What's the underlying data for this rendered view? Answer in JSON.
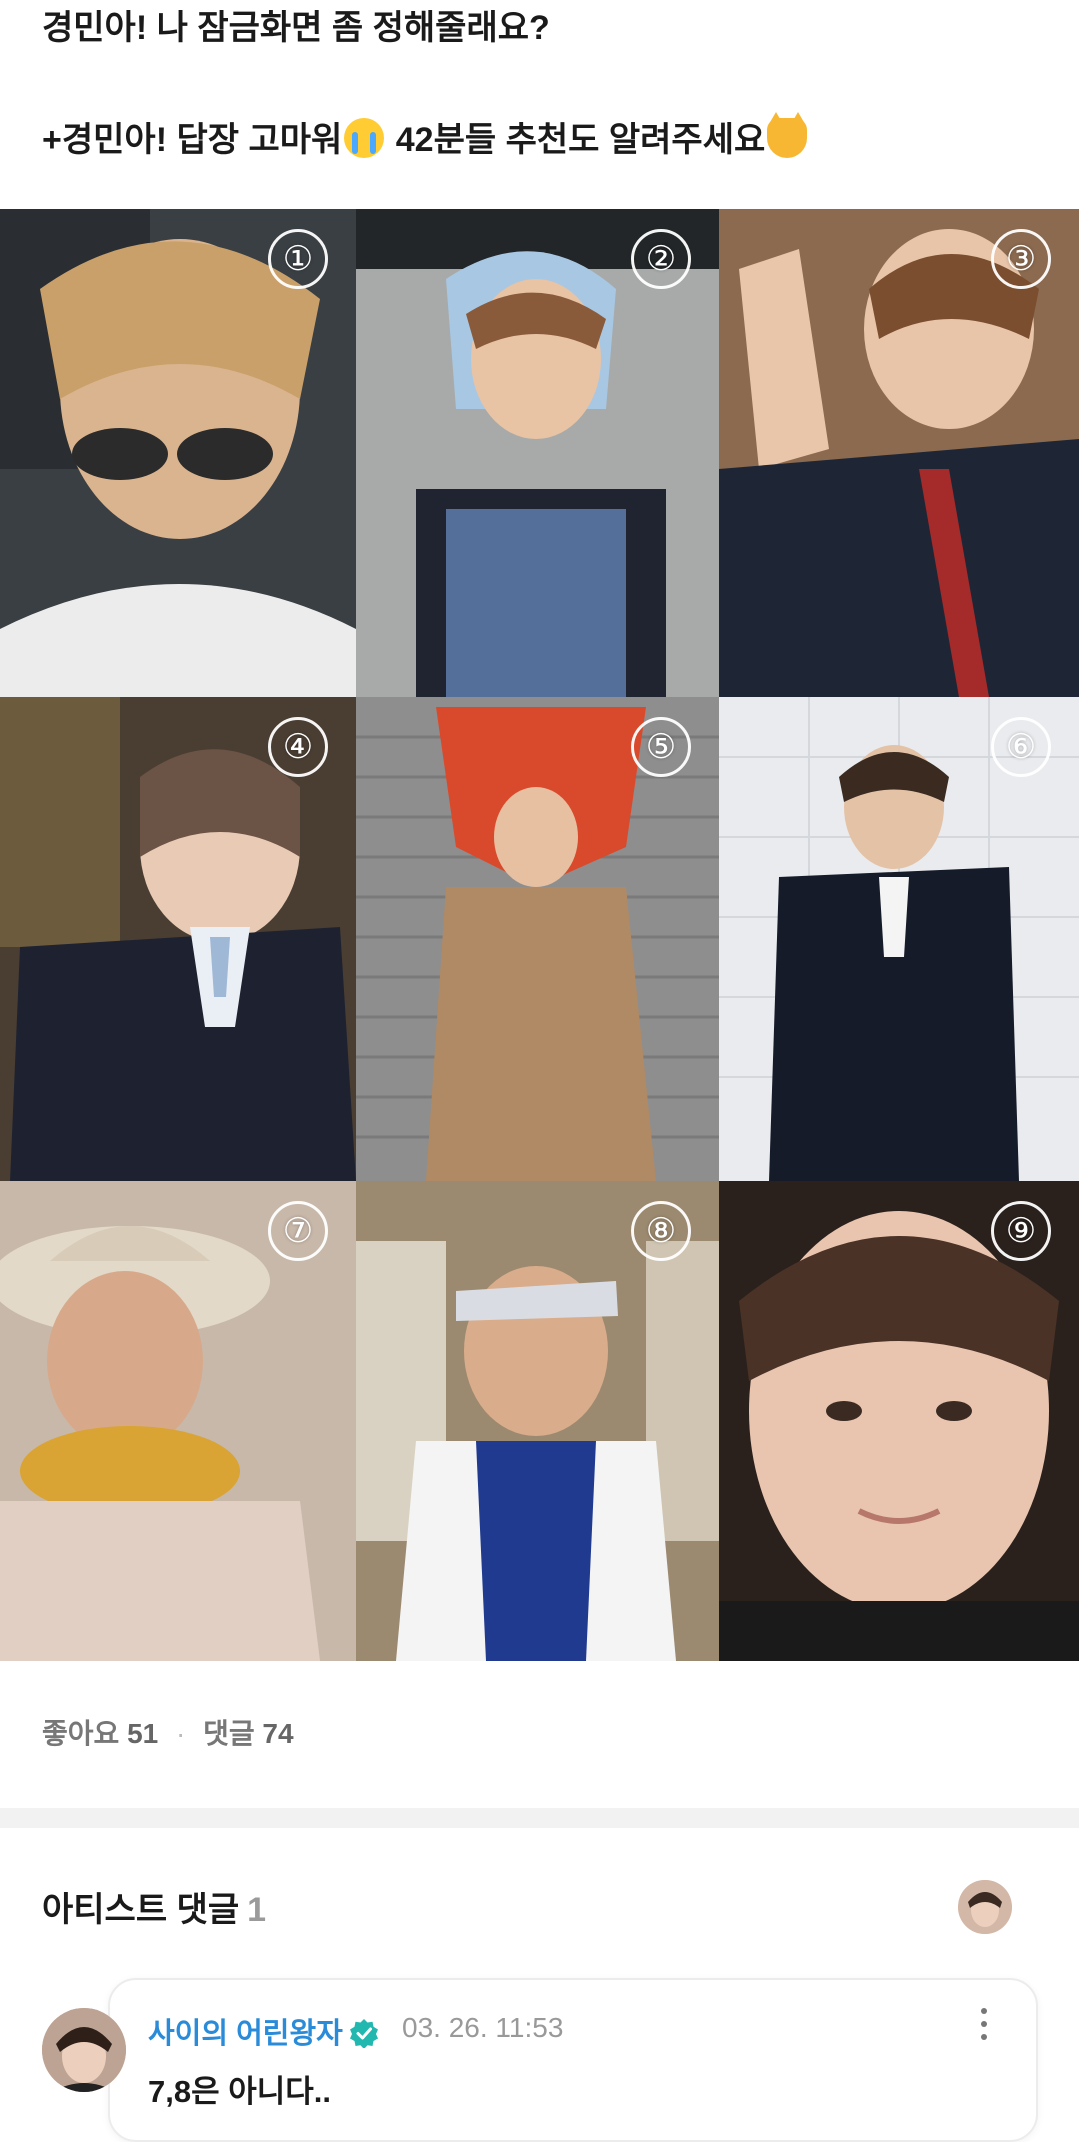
{
  "post": {
    "line1": "경민아! 나 잠금화면 좀 정해줄래요?",
    "line2_prefix": "+경민아! 답장 고마워",
    "line2_mid": " 42분들 추천도 알려주세요",
    "emoji_1": "loudly-crying-face",
    "emoji_2": "cat-face"
  },
  "photos": [
    {
      "label": "①"
    },
    {
      "label": "②"
    },
    {
      "label": "③"
    },
    {
      "label": "④"
    },
    {
      "label": "⑤"
    },
    {
      "label": "⑥"
    },
    {
      "label": "⑦"
    },
    {
      "label": "⑧"
    },
    {
      "label": "⑨"
    }
  ],
  "stats": {
    "likes_label": "좋아요",
    "likes_count": "51",
    "separator": "·",
    "comments_label": "댓글",
    "comments_count": "74"
  },
  "artist_comments": {
    "title": "아티스트 댓글",
    "count": "1",
    "items": [
      {
        "author": "사이의 어린왕자",
        "time": "03. 26. 11:53",
        "text": "7,8은 아니다..",
        "verified_icon": "verified-badge-icon"
      }
    ]
  },
  "colors": {
    "accent_blue": "#2a8bd8",
    "verified_teal": "#22b8b0",
    "muted_gray": "#777777"
  }
}
